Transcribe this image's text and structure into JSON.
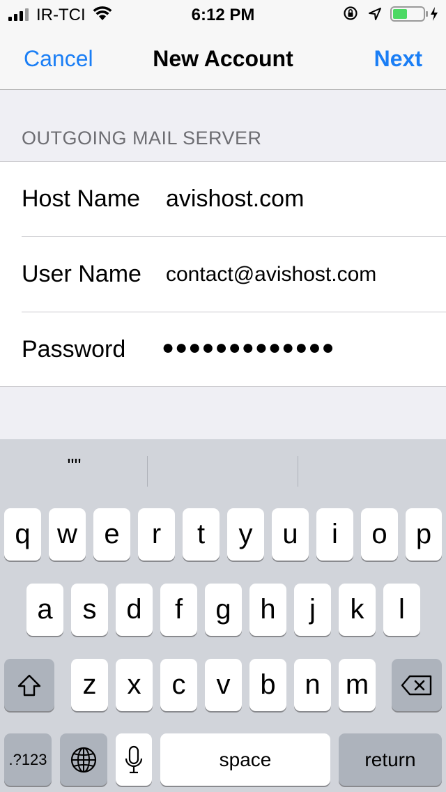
{
  "status_bar": {
    "carrier": "IR-TCI",
    "time": "6:12 PM"
  },
  "nav": {
    "cancel": "Cancel",
    "title": "New Account",
    "next": "Next"
  },
  "section": {
    "header": "OUTGOING MAIL SERVER"
  },
  "form": {
    "host_label": "Host Name",
    "host_value": "avishost.com",
    "user_label": "User Name",
    "user_value": "contact@avishost.com",
    "password_label": "Password",
    "password_value": "●●●●●●●●●●●●●"
  },
  "keyboard": {
    "suggestions": [
      "\"\"",
      "",
      ""
    ],
    "row1": [
      "q",
      "w",
      "e",
      "r",
      "t",
      "y",
      "u",
      "i",
      "o",
      "p"
    ],
    "row2": [
      "a",
      "s",
      "d",
      "f",
      "g",
      "h",
      "j",
      "k",
      "l"
    ],
    "row3": [
      "z",
      "x",
      "c",
      "v",
      "b",
      "n",
      "m"
    ],
    "numbers_key": ".?123",
    "space_key": "space",
    "return_key": "return",
    "icons": [
      "shift-icon",
      "backspace-icon",
      "globe-icon",
      "microphone-icon"
    ]
  },
  "colors": {
    "accent": "#1a7ef5",
    "battery": "#4cd964",
    "keyboard_bg": "#d1d4da"
  }
}
